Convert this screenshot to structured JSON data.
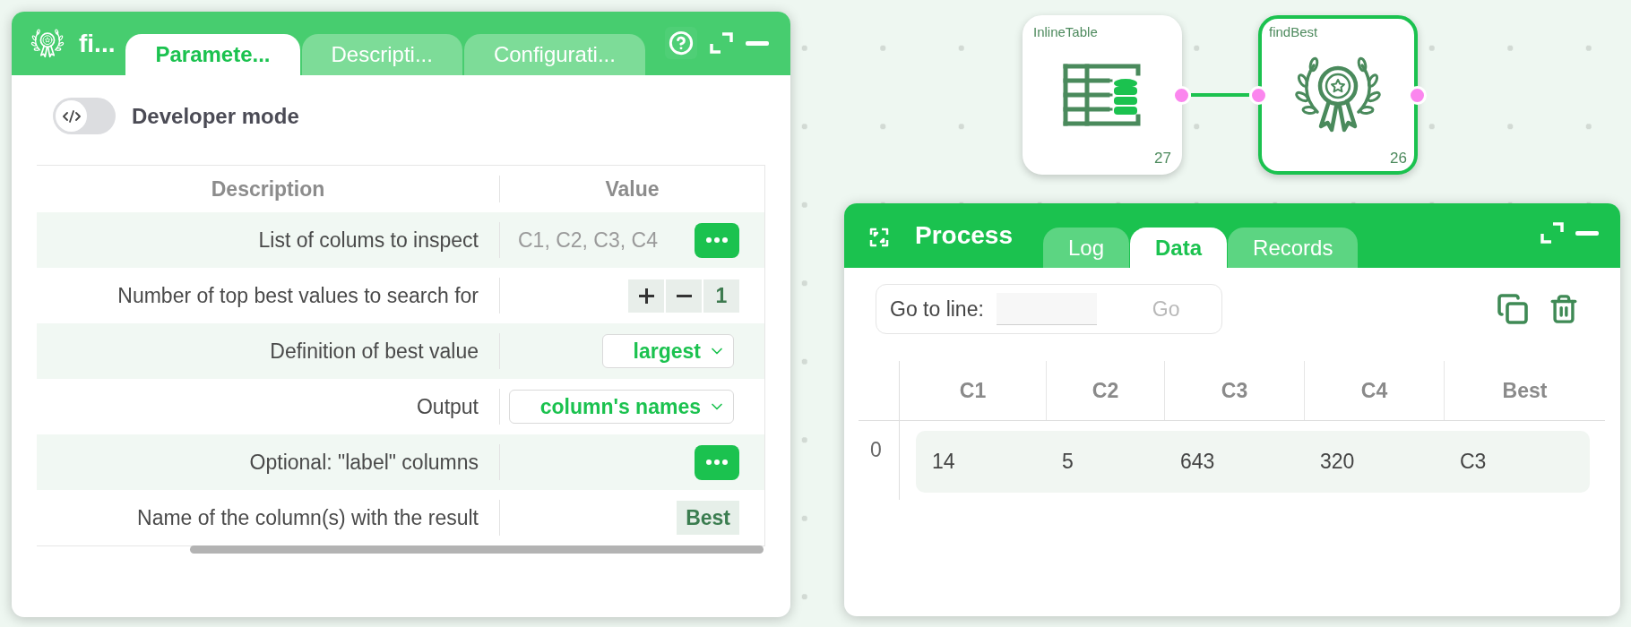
{
  "parameters_panel": {
    "title": "fi...",
    "tabs": [
      {
        "label": "Paramete...",
        "selected": true
      },
      {
        "label": "Descripti...",
        "selected": false
      },
      {
        "label": "Configurati...",
        "selected": false
      }
    ],
    "developer_mode": {
      "label": "Developer mode",
      "on": false
    },
    "table": {
      "columns": [
        "Description",
        "Value"
      ],
      "rows": [
        {
          "label": "List of colums to inspect",
          "kind": "list",
          "value": "C1, C2, C3, C4"
        },
        {
          "label": "Number of top best values to search for",
          "kind": "stepper",
          "value": "1"
        },
        {
          "label": "Definition of best value",
          "kind": "select",
          "value": "largest"
        },
        {
          "label": "Output",
          "kind": "select",
          "value": "column's names"
        },
        {
          "label": "Optional: \"label\" columns",
          "kind": "list"
        },
        {
          "label": "Name of the column(s) with the result",
          "kind": "text",
          "value": "Best"
        }
      ]
    }
  },
  "nodes": [
    {
      "title": "InlineTable",
      "kind": "table",
      "number": "27",
      "selected": false
    },
    {
      "title": "findBest",
      "kind": "award",
      "number": "26",
      "selected": true
    }
  ],
  "process_panel": {
    "title": "Process",
    "tabs": [
      {
        "label": "Log",
        "selected": false
      },
      {
        "label": "Data",
        "selected": true
      },
      {
        "label": "Records",
        "selected": false
      }
    ],
    "go_to_line": {
      "label": "Go to line:",
      "button": "Go",
      "disabled": true
    },
    "table": {
      "columns": [
        "C1",
        "C2",
        "C3",
        "C4",
        "Best"
      ],
      "rows": [
        {
          "index": "0",
          "cells": [
            "14",
            "5",
            "643",
            "320",
            "C3"
          ]
        }
      ]
    }
  }
}
